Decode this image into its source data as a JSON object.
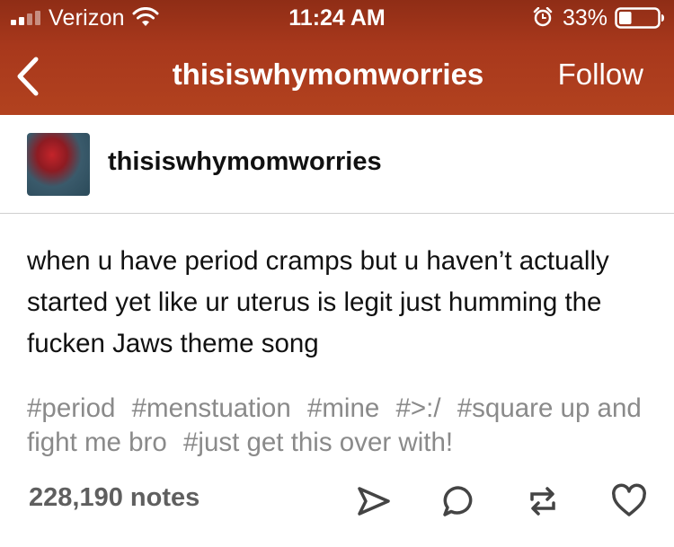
{
  "status_bar": {
    "carrier": "Verizon",
    "time": "11:24 AM",
    "battery_percent": "33%",
    "battery_level": 0.33,
    "icons": [
      "signal-icon",
      "wifi-icon",
      "alarm-icon",
      "battery-icon"
    ]
  },
  "nav": {
    "title": "thisiswhymomworries",
    "follow_label": "Follow",
    "back_icon": "chevron-left-icon",
    "background": "#a8381c"
  },
  "post": {
    "author": "thisiswhymomworries",
    "body": "when u have period cramps but u haven’t actually started yet like ur uterus is legit just humming the fucken Jaws theme song",
    "tags": [
      "#period",
      "#menstuation",
      "#mine",
      "#>:/",
      "#square up and fight me bro",
      "#just get this over with!"
    ],
    "notes": "228,190 notes",
    "actions": [
      "share-icon",
      "reply-icon",
      "reblog-icon",
      "like-icon"
    ]
  }
}
